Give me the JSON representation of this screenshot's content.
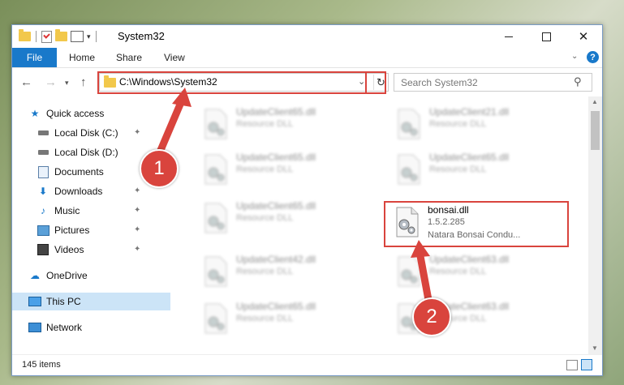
{
  "window": {
    "title": "System32",
    "controls": {
      "minimize": "minimize",
      "maximize": "maximize",
      "close": "✕"
    }
  },
  "ribbon": {
    "tabs": [
      "File",
      "Home",
      "Share",
      "View"
    ],
    "help": "?"
  },
  "nav": {
    "address": "C:\\Windows\\System32",
    "search_placeholder": "Search System32"
  },
  "sidebar": {
    "items": [
      {
        "label": "Quick access",
        "icon": "star-icon"
      },
      {
        "label": "Local Disk (C:)",
        "icon": "disk-icon",
        "pinned": true
      },
      {
        "label": "Local Disk (D:)",
        "icon": "disk-icon"
      },
      {
        "label": "Documents",
        "icon": "documents-icon"
      },
      {
        "label": "Downloads",
        "icon": "download-icon",
        "pinned": true
      },
      {
        "label": "Music",
        "icon": "music-icon",
        "pinned": true
      },
      {
        "label": "Pictures",
        "icon": "pictures-icon",
        "pinned": true
      },
      {
        "label": "Videos",
        "icon": "videos-icon",
        "pinned": true
      },
      {
        "label": "OneDrive",
        "icon": "cloud-icon"
      },
      {
        "label": "This PC",
        "icon": "computer-icon",
        "selected": true
      },
      {
        "label": "Network",
        "icon": "network-icon"
      }
    ]
  },
  "files": [
    {
      "name": "UpdateClient65.dll",
      "type": "Resource DLL"
    },
    {
      "name": "UpdateClient21.dll",
      "type": "Resource DLL"
    },
    {
      "name": "UpdateClient65.dll",
      "type": "Resource DLL"
    },
    {
      "name": "UpdateClient65.dll",
      "type": "Resource DLL"
    },
    {
      "name": "UpdateClient65.dll",
      "type": "Resource DLL"
    },
    {
      "name": "bonsai.dll",
      "version": "1.5.2.285",
      "description": "Natara Bonsai Condu..."
    },
    {
      "name": "UpdateClient42.dll",
      "type": "Resource DLL"
    },
    {
      "name": "UpdateClient63.dll",
      "type": "Resource DLL"
    },
    {
      "name": "UpdateClient65.dll",
      "type": "Resource DLL"
    },
    {
      "name": "UpdateClient63.dll",
      "type": "Resource DLL"
    }
  ],
  "status": {
    "count": "145 items"
  },
  "annotations": {
    "step1": "1",
    "step2": "2"
  },
  "colors": {
    "accent": "#1979ca",
    "highlight": "#d9443d",
    "selected": "#cce4f7"
  }
}
